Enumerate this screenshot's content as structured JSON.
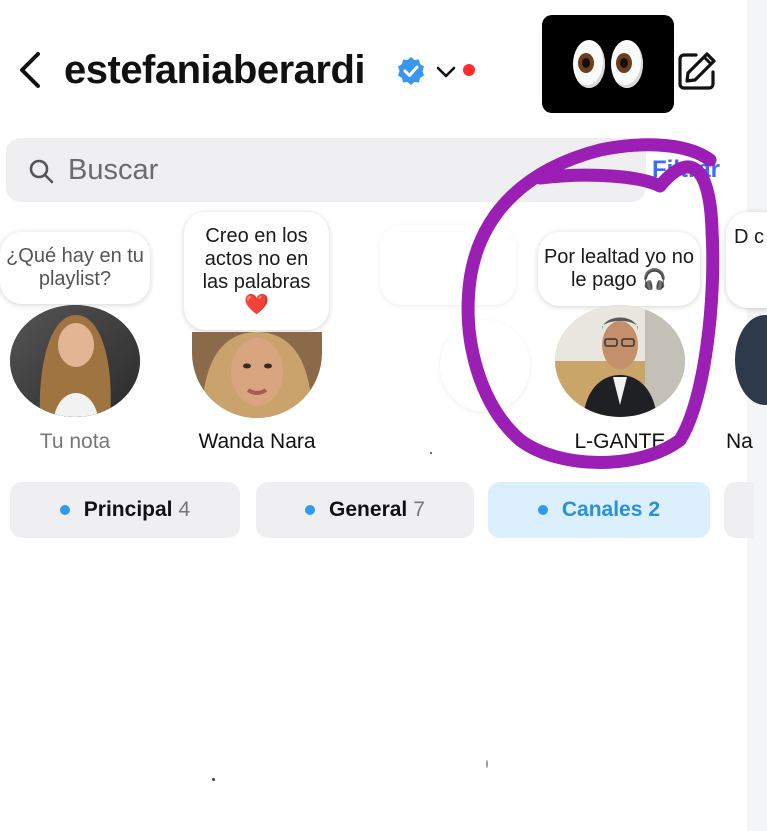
{
  "header": {
    "username": "estefaniaberardi",
    "back_icon": "chevron-left-icon",
    "verified_icon": "verified-badge-icon",
    "dropdown_icon": "chevron-down-icon",
    "compose_icon": "compose-icon",
    "sticker": "eyes-emoji"
  },
  "search": {
    "placeholder": "Buscar",
    "filter_label": "Filtrar"
  },
  "notes": [
    {
      "note": "¿Qué hay en tu playlist?",
      "name": "Tu nota"
    },
    {
      "note": "Creo en los actos no en las palabras ❤️",
      "name": "Wanda Nara"
    },
    {
      "note": "",
      "name": ""
    },
    {
      "note": "Por lealtad yo no le pago 🎧",
      "name": "L-GANTE"
    },
    {
      "note": "D c s",
      "name": "Na"
    }
  ],
  "tabs": [
    {
      "label": "Principal",
      "count": "4"
    },
    {
      "label": "General",
      "count": "7"
    },
    {
      "label": "Canales",
      "count": "2"
    }
  ],
  "colors": {
    "accent": "#3b6cf5",
    "annotation": "#9b1fb5",
    "active_tab_bg": "#dbeffd",
    "unread_dot": "#2e9bf0"
  }
}
